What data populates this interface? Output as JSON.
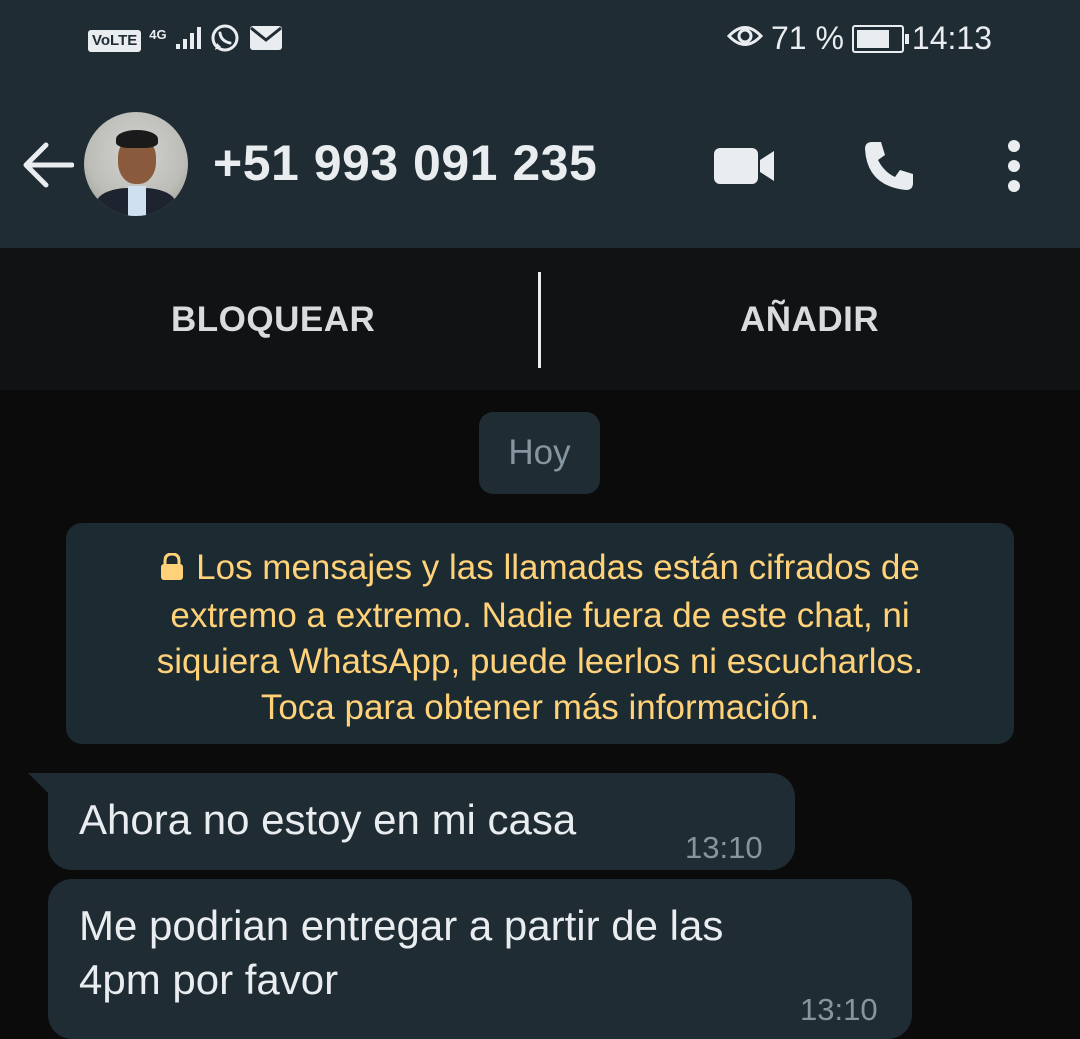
{
  "status_bar": {
    "volte": "VoLTE",
    "network": "4G",
    "battery_percent": "71 %",
    "time": "14:13",
    "icons": [
      "signal-icon",
      "whatsapp-icon",
      "mail-icon",
      "eye-icon",
      "battery-charging-icon"
    ]
  },
  "header": {
    "contact_name": "+51 993 091 235",
    "icons": [
      "back-arrow-icon",
      "video-call-icon",
      "phone-icon",
      "more-vert-icon"
    ]
  },
  "actions": {
    "block_label": "BLOQUEAR",
    "add_label": "AÑADIR"
  },
  "chat": {
    "date_chip": "Hoy",
    "encryption_notice": {
      "lines": [
        "Los mensajes y las llamadas están cifrados de",
        "extremo a extremo. Nadie fuera de este chat, ni",
        "siquiera WhatsApp, puede leerlos ni escucharlos.",
        "Toca para obtener más información."
      ]
    },
    "messages": [
      {
        "lines": [
          "Ahora no estoy en mi casa"
        ],
        "time": "13:10"
      },
      {
        "lines": [
          "Me podrian entregar a partir de las",
          "4pm por favor"
        ],
        "time": "13:10"
      }
    ]
  },
  "colors": {
    "header_bg": "#1f2c34",
    "chat_bg": "#0b0b0b",
    "bubble_bg": "#1f2c34",
    "notice_text": "#ffd279",
    "timestamp": "#8696a0"
  }
}
